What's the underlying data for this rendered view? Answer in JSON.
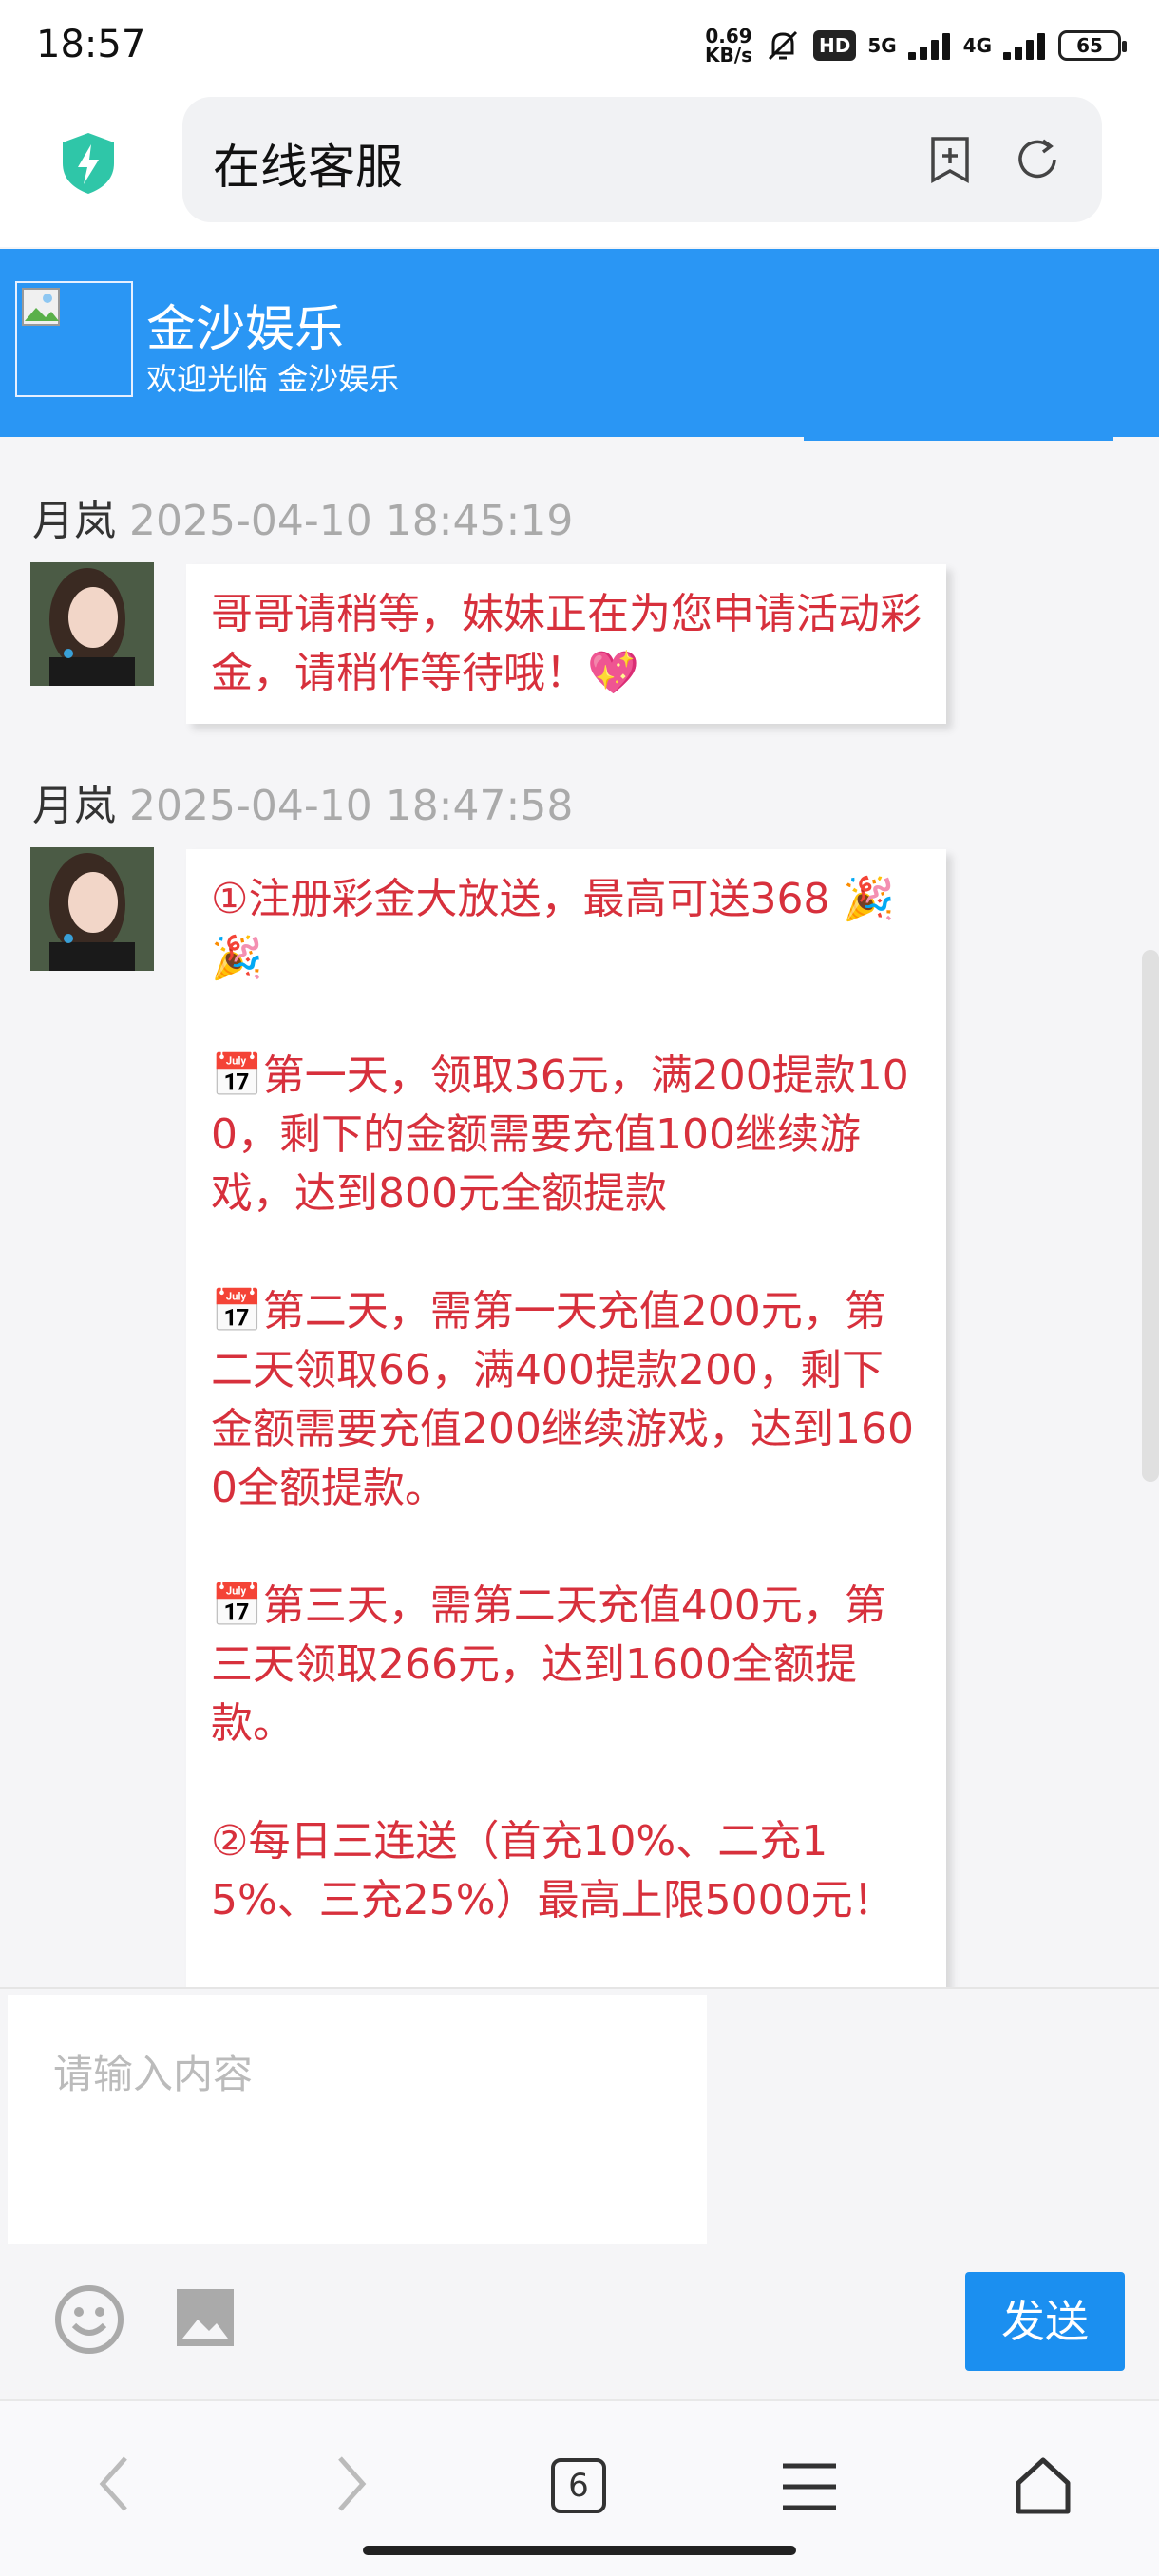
{
  "status_bar": {
    "time": "18:57",
    "net_speed_value": "0.69",
    "net_speed_unit": "KB/s",
    "hd_badge": "HD",
    "signal1": "5G",
    "signal2": "4G",
    "battery": "65"
  },
  "browser": {
    "title": "在线客服"
  },
  "chat_header": {
    "title": "金沙娱乐",
    "subtitle": "欢迎光临 金沙娱乐"
  },
  "messages": [
    {
      "sender": "月岚",
      "timestamp": "2025-04-10 18:45:19",
      "text": "哥哥请稍等，妹妹正在为您申请活动彩金，请稍作等待哦！💖"
    },
    {
      "sender": "月岚",
      "timestamp": "2025-04-10 18:47:58",
      "text": "①注册彩金大放送，最高可送368 🎉🎉\n\n📅第一天，领取36元，满200提款100，剩下的金额需要充值100继续游戏，达到800元全额提款\n\n📅第二天，需第一天充值200元，第二天领取66，满400提款200，剩下金额需要充值200继续游戏，达到1600全额提款。\n\n📅第三天，需第二天充值400元，第三天领取266元，达到1600全额提款。\n\n②每日三连送（首充10%、二充15%、三充25%）最高上限5000元！"
    }
  ],
  "composer": {
    "placeholder": "请输入内容",
    "send_label": "发送"
  },
  "bottom_nav": {
    "tab_count": "6"
  }
}
